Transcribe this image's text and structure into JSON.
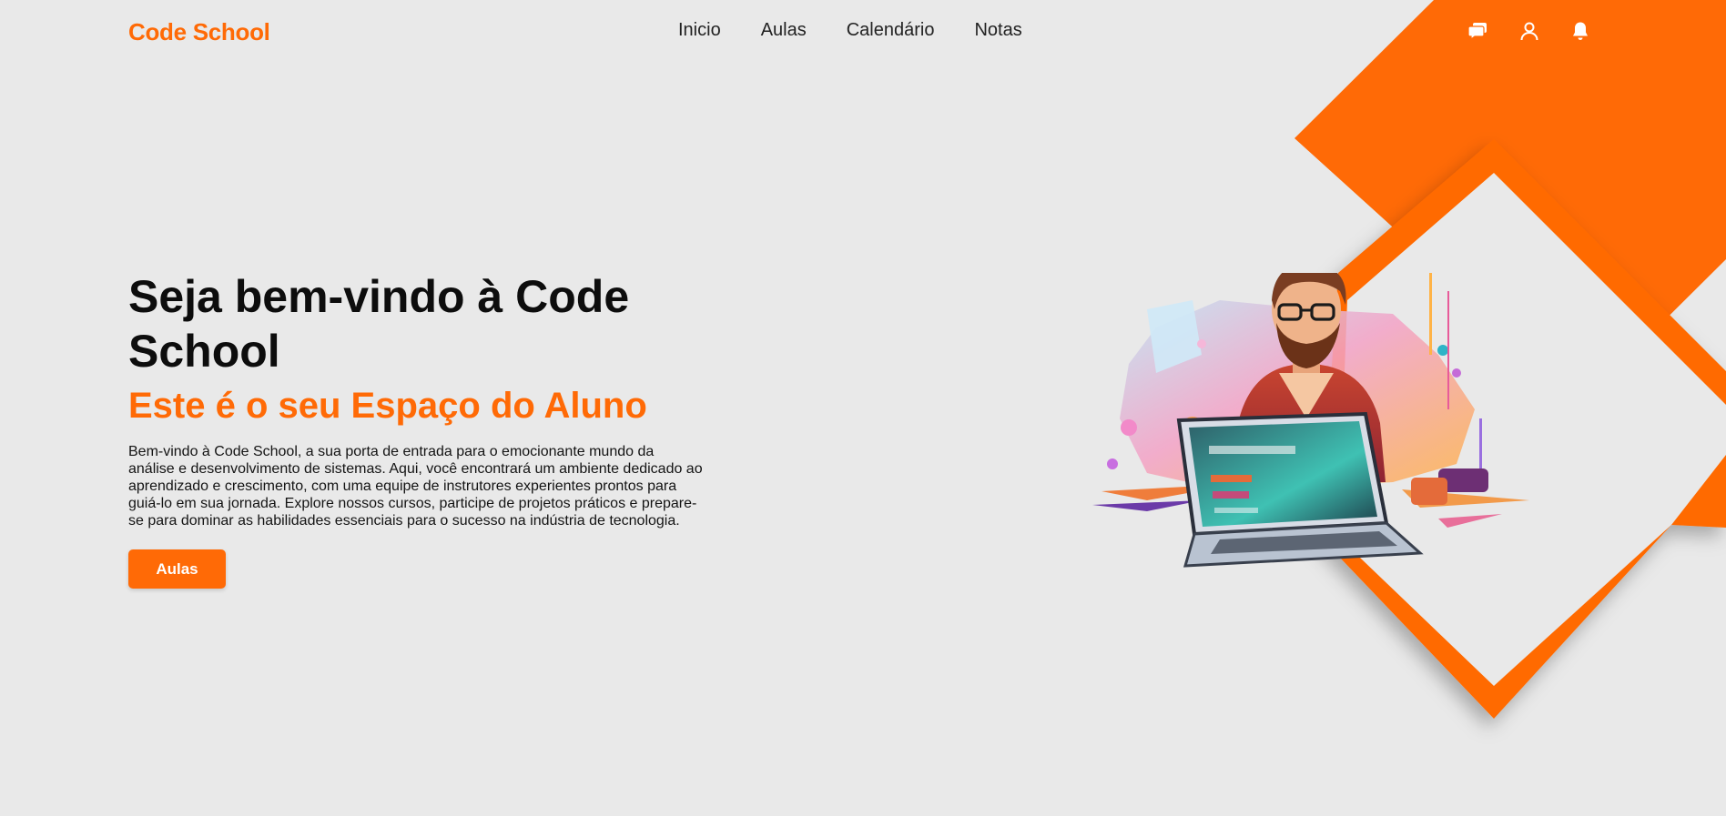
{
  "brand": "Code School",
  "nav": [
    "Inicio",
    "Aulas",
    "Calendário",
    "Notas"
  ],
  "header_icons": [
    "chat-icon",
    "user-icon",
    "bell-icon"
  ],
  "hero": {
    "title": "Seja bem-vindo à Code School",
    "subtitle": "Este é o seu Espaço do Aluno",
    "body": "Bem-vindo à Code School, a sua porta de entrada para o emocionante mundo da análise e desenvolvimento de sistemas. Aqui, você encontrará um ambiente dedicado ao aprendizado e crescimento, com uma equipe de instrutores experientes prontos para guiá-lo em sua jornada. Explore nossos cursos, participe de projetos práticos e prepare-se para dominar as habilidades essenciais para o sucesso na indústria de tecnologia.",
    "cta_label": "Aulas"
  },
  "colors": {
    "accent": "#ff6a06",
    "background": "#e9e9e9",
    "text": "#111111"
  }
}
